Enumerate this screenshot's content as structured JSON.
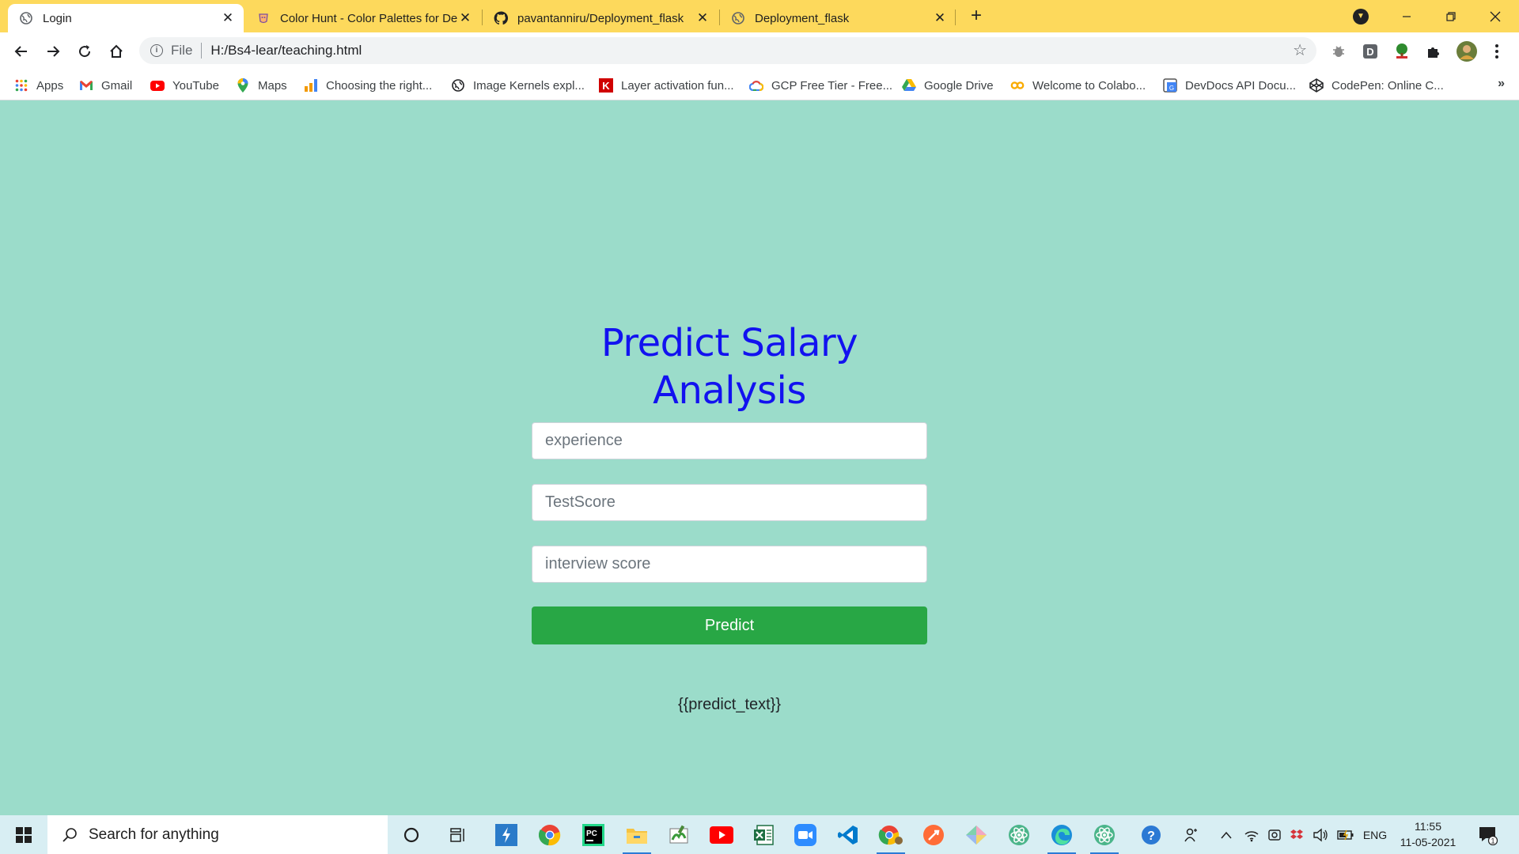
{
  "browser": {
    "tabs": [
      {
        "title": "Login",
        "active": true,
        "favicon": "globe-icon"
      },
      {
        "title": "Color Hunt - Color Palettes for De",
        "active": false,
        "favicon": "color-hunt-icon"
      },
      {
        "title": "pavantanniru/Deployment_flask",
        "active": false,
        "favicon": "github-icon"
      },
      {
        "title": "Deployment_flask",
        "active": false,
        "favicon": "globe-icon"
      }
    ],
    "new_tab_label": "+",
    "omnibox": {
      "scheme": "File",
      "url": "H:/Bs4-lear/teaching.html"
    },
    "bookmarks": [
      {
        "label": "Apps",
        "icon": "apps-grid-icon"
      },
      {
        "label": "Gmail",
        "icon": "gmail-icon"
      },
      {
        "label": "YouTube",
        "icon": "youtube-icon"
      },
      {
        "label": "Maps",
        "icon": "maps-icon"
      },
      {
        "label": "Choosing the right...",
        "icon": "chart-icon"
      },
      {
        "label": "Image Kernels expl...",
        "icon": "globe-icon"
      },
      {
        "label": "Layer activation fun...",
        "icon": "k-icon"
      },
      {
        "label": "GCP Free Tier - Free...",
        "icon": "gcp-icon"
      },
      {
        "label": "Google Drive",
        "icon": "drive-icon"
      },
      {
        "label": "Welcome to Colabo...",
        "icon": "colab-icon"
      },
      {
        "label": "DevDocs API Docu...",
        "icon": "devdocs-icon"
      },
      {
        "label": "CodePen: Online C...",
        "icon": "codepen-icon"
      }
    ],
    "bookmarks_more": "»"
  },
  "page": {
    "heading": "Predict Salary Analysis",
    "fields": [
      {
        "placeholder": "experience"
      },
      {
        "placeholder": "TestScore"
      },
      {
        "placeholder": "interview score"
      }
    ],
    "button_label": "Predict",
    "result_text": "{{predict_text}}",
    "colors": {
      "background": "#9bdcca",
      "heading": "#1212f0",
      "button": "#28a745"
    }
  },
  "taskbar": {
    "search_placeholder": "Search for anything",
    "language": "ENG",
    "time": "11:55",
    "date": "11-05-2021",
    "notification_count": "1"
  }
}
